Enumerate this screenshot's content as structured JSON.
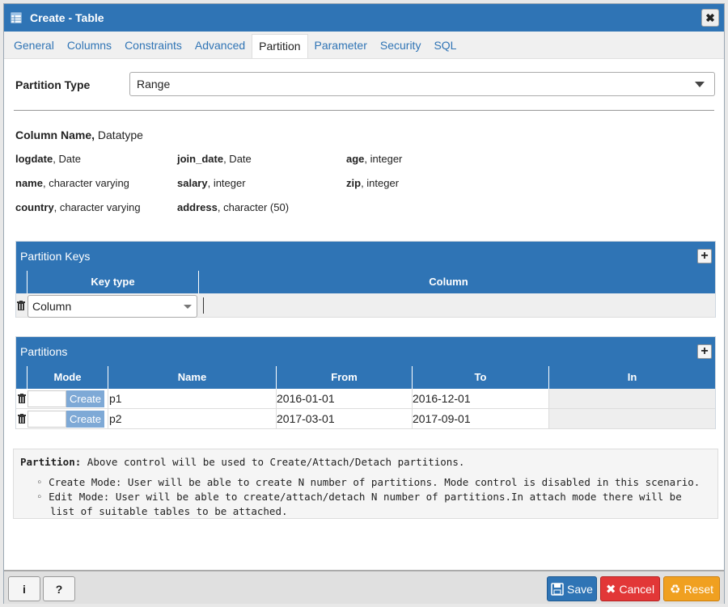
{
  "dialog": {
    "title": "Create - Table",
    "close_glyph": "✖"
  },
  "tabs": [
    "General",
    "Columns",
    "Constraints",
    "Advanced",
    "Partition",
    "Parameter",
    "Security",
    "SQL"
  ],
  "partition_type": {
    "label": "Partition Type",
    "value": "Range"
  },
  "columns_info": {
    "heading_bold": "Column Name,",
    "heading_rest": " Datatype",
    "items": [
      {
        "name": "logdate",
        "type": ", Date"
      },
      {
        "name": "join_date",
        "type": ", Date"
      },
      {
        "name": "age",
        "type": ", integer"
      },
      {
        "name": "name",
        "type": ", character varying"
      },
      {
        "name": "salary",
        "type": ", integer"
      },
      {
        "name": "zip",
        "type": ", integer"
      },
      {
        "name": "country",
        "type": ", character varying"
      },
      {
        "name": "address",
        "type": ", character (50)"
      }
    ]
  },
  "partition_keys": {
    "title": "Partition Keys",
    "headers": [
      "Key type",
      "Column"
    ],
    "rows": [
      {
        "key_type": "Column",
        "column": ""
      }
    ]
  },
  "partitions": {
    "title": "Partitions",
    "headers": [
      "Mode",
      "Name",
      "From",
      "To",
      "In"
    ],
    "rows": [
      {
        "mode": "Create",
        "name": "p1",
        "from": "2016-01-01",
        "to": "2016-12-01",
        "in": ""
      },
      {
        "mode": "Create",
        "name": "p2",
        "from": "2017-03-01",
        "to": "2017-09-01",
        "in": ""
      }
    ]
  },
  "info": {
    "label": "Partition:",
    "text": "  Above control will be used to Create/Attach/Detach partitions.",
    "bullets": [
      "Create Mode: User will be able to create N number of partitions. Mode control is disabled in this scenario.",
      "Edit Mode: User will be able to create/attach/detach N number of partitions.In attach mode there will be",
      "list of suitable tables to be attached."
    ]
  },
  "footer": {
    "info_label": "i",
    "help_label": "?",
    "save_label": "Save",
    "cancel_label": "Cancel",
    "reset_label": "Reset"
  },
  "colors": {
    "accent": "#2f74b5",
    "cancel": "#e23737",
    "reset": "#f0a020"
  }
}
